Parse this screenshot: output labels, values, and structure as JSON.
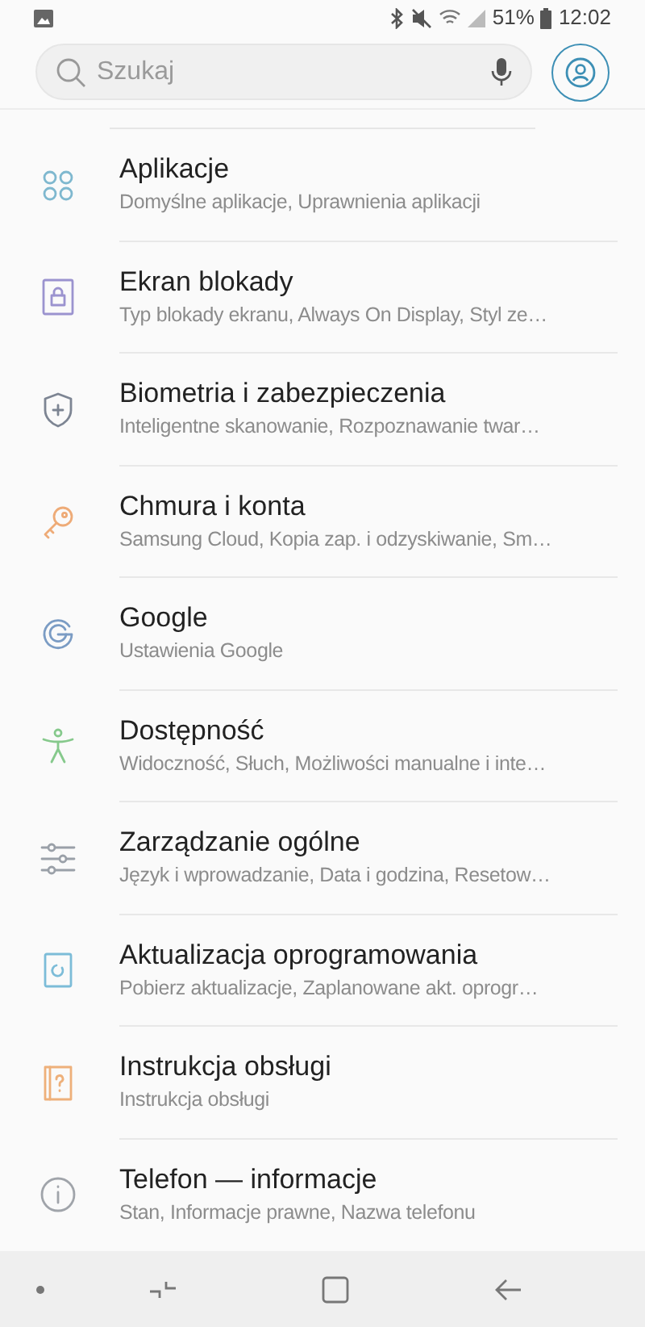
{
  "status_bar": {
    "battery": "51%",
    "time": "12:02"
  },
  "search": {
    "placeholder": "Szukaj"
  },
  "items": [
    {
      "kind": "apps",
      "color": "#7fb8cf",
      "title": "Aplikacje",
      "subtitle": "Domyślne aplikacje, Uprawnienia aplikacji"
    },
    {
      "kind": "lock",
      "color": "#9b93cf",
      "title": "Ekran blokady",
      "subtitle": "Typ blokady ekranu, Always On Display, Styl ze…"
    },
    {
      "kind": "shield",
      "color": "#7d8593",
      "title": "Biometria i zabezpieczenia",
      "subtitle": "Inteligentne skanowanie, Rozpoznawanie twar…"
    },
    {
      "kind": "key",
      "color": "#eeab77",
      "title": "Chmura i konta",
      "subtitle": "Samsung Cloud, Kopia zap. i odzyskiwanie, Sm…"
    },
    {
      "kind": "google",
      "color": "#7b9cc4",
      "title": "Google",
      "subtitle": "Ustawienia Google"
    },
    {
      "kind": "person",
      "color": "#86c98c",
      "title": "Dostępność",
      "subtitle": "Widoczność, Słuch, Możliwości manualne i inte…"
    },
    {
      "kind": "sliders",
      "color": "#9aa0a8",
      "title": "Zarządzanie ogólne",
      "subtitle": "Język i wprowadzanie, Data i godzina, Resetow…"
    },
    {
      "kind": "update",
      "color": "#7cbcd8",
      "title": "Aktualizacja oprogramowania",
      "subtitle": "Pobierz aktualizacje, Zaplanowane akt. oprogr…"
    },
    {
      "kind": "manual",
      "color": "#eeb07a",
      "title": "Instrukcja obsługi",
      "subtitle": "Instrukcja obsługi"
    },
    {
      "kind": "info",
      "color": "#a0a4aa",
      "title": "Telefon — informacje",
      "subtitle": "Stan, Informacje prawne, Nazwa telefonu"
    }
  ]
}
